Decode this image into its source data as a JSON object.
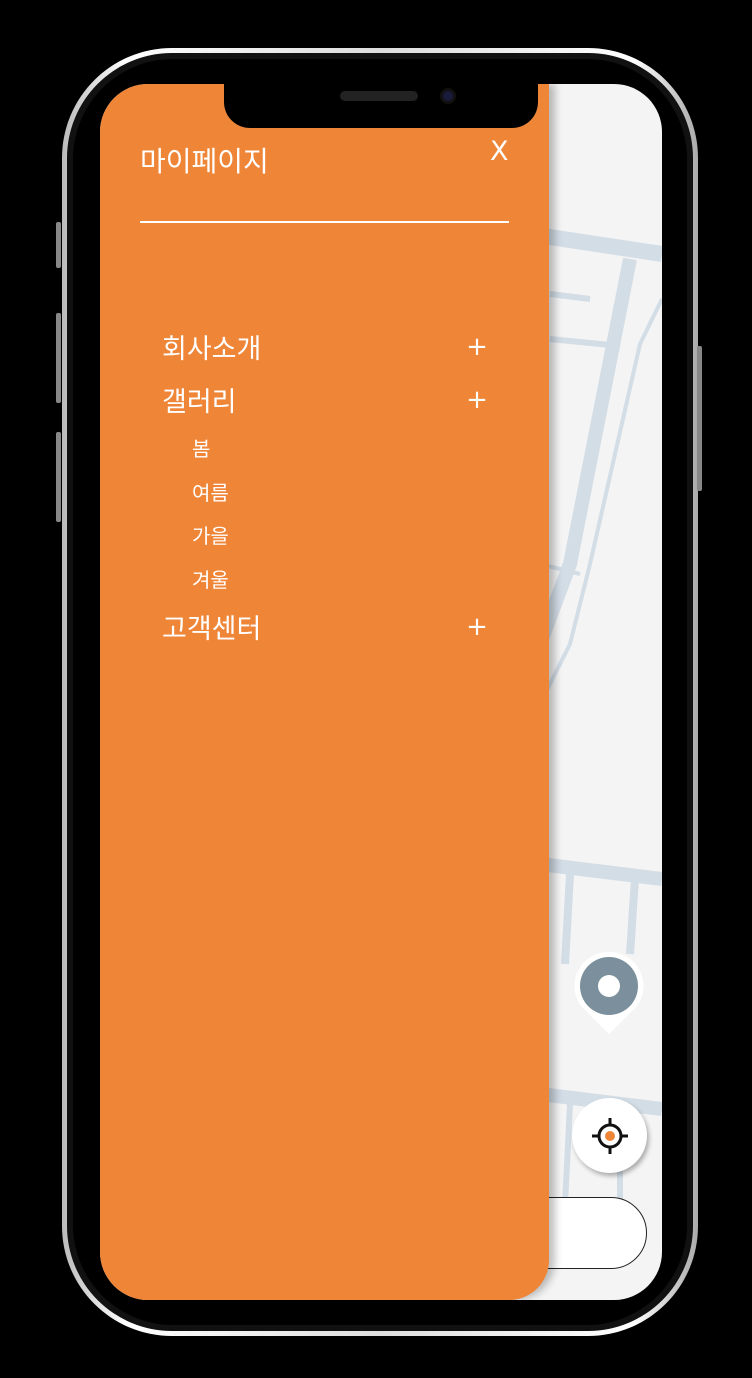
{
  "drawer": {
    "title": "마이페이지",
    "close_label": "X",
    "menu": [
      {
        "label": "회사소개",
        "toggle": "+"
      },
      {
        "label": "갤러리",
        "toggle": "+",
        "children": [
          "봄",
          "여름",
          "가을",
          "겨울"
        ]
      },
      {
        "label": "고객센터",
        "toggle": "+"
      }
    ]
  },
  "colors": {
    "accent": "#ef8537",
    "map_road": "#d3dde6",
    "pin": "#7b909c"
  }
}
